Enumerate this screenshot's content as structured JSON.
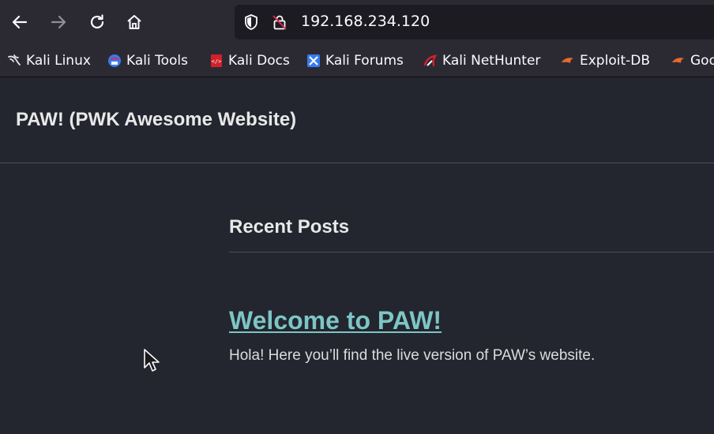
{
  "browser": {
    "url": "192.168.234.120",
    "toolbar_icons": [
      "back-arrow-icon",
      "forward-arrow-icon",
      "reload-icon",
      "home-icon",
      "shield-icon",
      "insecure-lock-icon"
    ],
    "bookmarks": [
      {
        "label": "Kali Linux",
        "icon": "kali-dragon-icon"
      },
      {
        "label": "Kali Tools",
        "icon": "kali-tools-icon"
      },
      {
        "label": "Kali Docs",
        "icon": "kali-docs-icon"
      },
      {
        "label": "Kali Forums",
        "icon": "kali-forums-icon"
      },
      {
        "label": "Kali NetHunter",
        "icon": "kali-nethunter-icon"
      },
      {
        "label": "Exploit-DB",
        "icon": "exploit-db-icon"
      },
      {
        "label": "Goo",
        "icon": "google-hacking-db-icon"
      }
    ]
  },
  "site": {
    "title": "PAW! (PWK Awesome Website)"
  },
  "main": {
    "section_title": "Recent Posts",
    "posts": [
      {
        "title": "Welcome to PAW!",
        "excerpt": "Hola! Here you’ll find the live version of PAW’s website."
      }
    ]
  },
  "colors": {
    "toolbar_bg": "#2b2a33",
    "urlbar_bg": "#1c1b22",
    "page_bg": "#23262f",
    "link": "#7ec5c5",
    "bookmark_orange": "#e8692a",
    "kali_red": "#d2202b",
    "kali_blue": "#367bf0"
  }
}
